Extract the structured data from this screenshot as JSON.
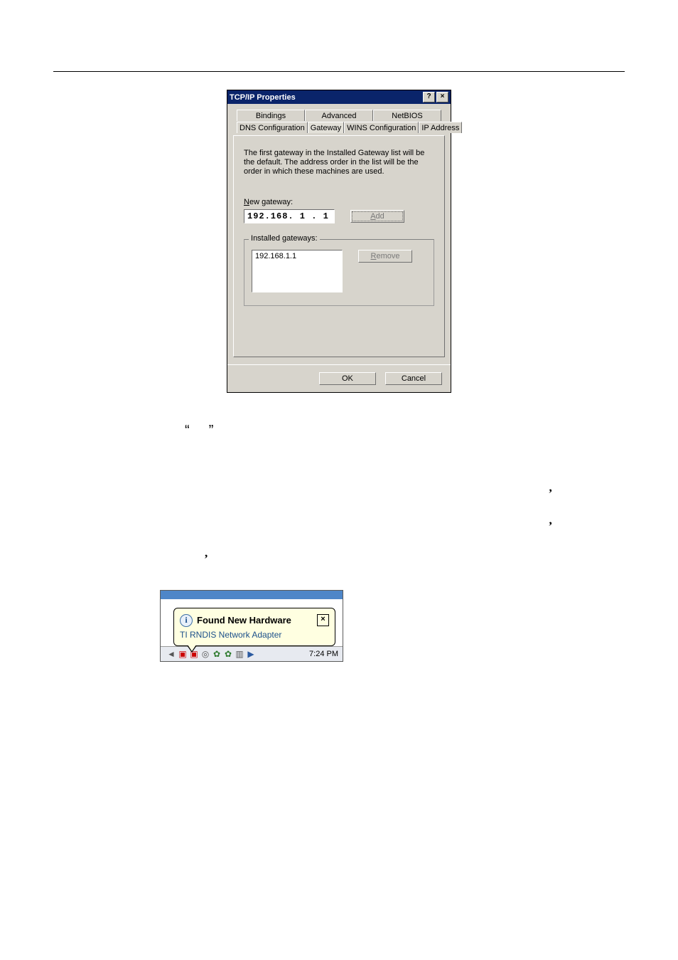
{
  "dialog": {
    "title": "TCP/IP Properties",
    "help_glyph": "?",
    "close_glyph": "×",
    "tabs_back": [
      "Bindings",
      "Advanced",
      "NetBIOS"
    ],
    "tabs_front": [
      "DNS Configuration",
      "Gateway",
      "WINS Configuration",
      "IP Address"
    ],
    "description": "The first gateway in the Installed Gateway list will be the default. The address order in the list will be the order in which these machines are used.",
    "new_gateway_label_pre": "N",
    "new_gateway_label_post": "ew gateway:",
    "new_gateway_value": "192.168.  1 .  1",
    "add_btn_pre": "A",
    "add_btn_post": "dd",
    "installed_legend_pre": "I",
    "installed_legend_post": "nstalled gateways:",
    "installed_value": "192.168.1.1",
    "remove_btn_pre": "R",
    "remove_btn_post": "emove",
    "ok_label": "OK",
    "cancel_label": "Cancel"
  },
  "doc": {
    "quote_open": "“",
    "quote_close": "”"
  },
  "notif": {
    "title": "Found New Hardware",
    "message": "TI RNDIS Network Adapter",
    "close_glyph": "×",
    "time": "7:24 PM"
  },
  "tray_icons": [
    "◄",
    "▣",
    "▣",
    "◎",
    "✿",
    "✿",
    "▥",
    "▶"
  ]
}
